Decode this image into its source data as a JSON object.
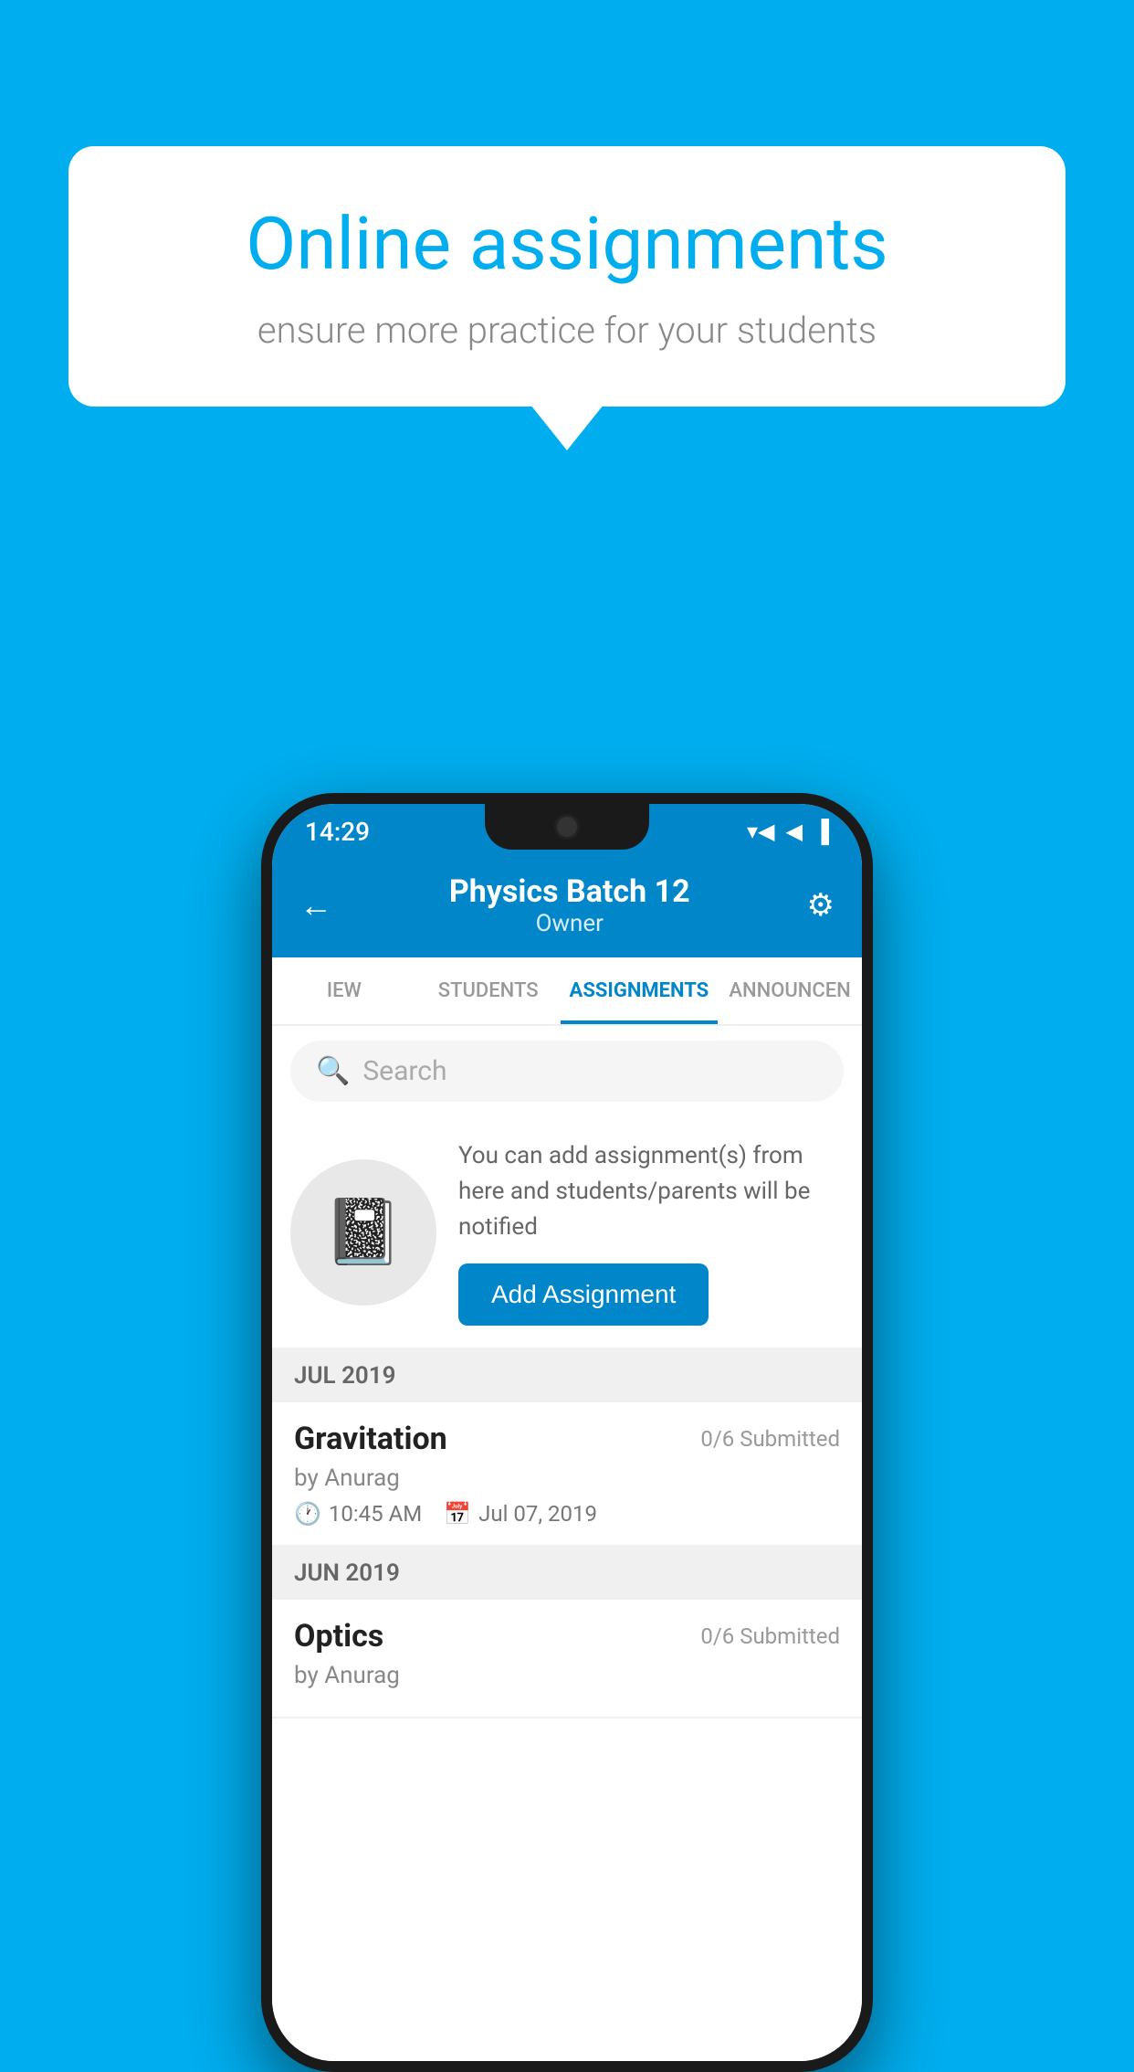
{
  "background": {
    "color": "#00AEEF"
  },
  "speech_bubble": {
    "title": "Online assignments",
    "subtitle": "ensure more practice for your students"
  },
  "phone": {
    "status_bar": {
      "time": "14:29",
      "wifi": "▾",
      "signal": "▲",
      "battery": "▐"
    },
    "header": {
      "back_label": "←",
      "title": "Physics Batch 12",
      "subtitle": "Owner",
      "settings_label": "⚙"
    },
    "tabs": [
      {
        "label": "IEW",
        "active": false
      },
      {
        "label": "STUDENTS",
        "active": false
      },
      {
        "label": "ASSIGNMENTS",
        "active": true
      },
      {
        "label": "ANNOUNCEN",
        "active": false
      }
    ],
    "search": {
      "placeholder": "Search"
    },
    "promo": {
      "description": "You can add assignment(s) from here and students/parents will be notified",
      "button_label": "Add Assignment"
    },
    "sections": [
      {
        "header": "JUL 2019",
        "assignments": [
          {
            "title": "Gravitation",
            "submitted": "0/6 Submitted",
            "author": "by Anurag",
            "time": "10:45 AM",
            "date": "Jul 07, 2019"
          }
        ]
      },
      {
        "header": "JUN 2019",
        "assignments": [
          {
            "title": "Optics",
            "submitted": "0/6 Submitted",
            "author": "by Anurag",
            "time": "",
            "date": ""
          }
        ]
      }
    ]
  }
}
